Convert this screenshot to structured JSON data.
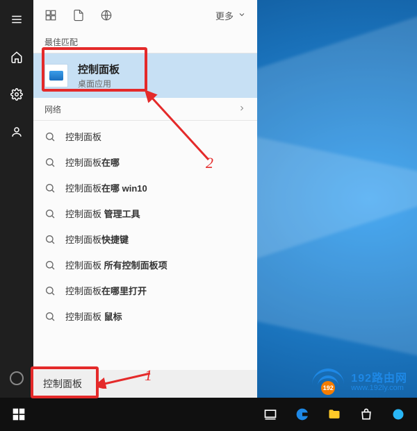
{
  "topbar": {
    "more_label": "更多"
  },
  "sections": {
    "best_match": "最佳匹配",
    "network": "网络"
  },
  "best_match_item": {
    "title": "控制面板",
    "subtitle": "桌面应用"
  },
  "results": [
    {
      "plain": "控制面板",
      "bold": ""
    },
    {
      "plain": "控制面板",
      "bold": "在哪"
    },
    {
      "plain": "控制面板",
      "bold": "在哪 win10"
    },
    {
      "plain": "控制面板 ",
      "bold": "管理工具"
    },
    {
      "plain": "控制面板",
      "bold": "快捷键"
    },
    {
      "plain": "控制面板 ",
      "bold": "所有控制面板项"
    },
    {
      "plain": "控制面板",
      "bold": "在哪里打开"
    },
    {
      "plain": "控制面板 ",
      "bold": "鼠标"
    }
  ],
  "search": {
    "value": "控制面板"
  },
  "annotations": {
    "label1": "1",
    "label2": "2"
  },
  "brand": {
    "line1": "192路由网",
    "line2": "www.192ly.com",
    "badge": "192"
  }
}
